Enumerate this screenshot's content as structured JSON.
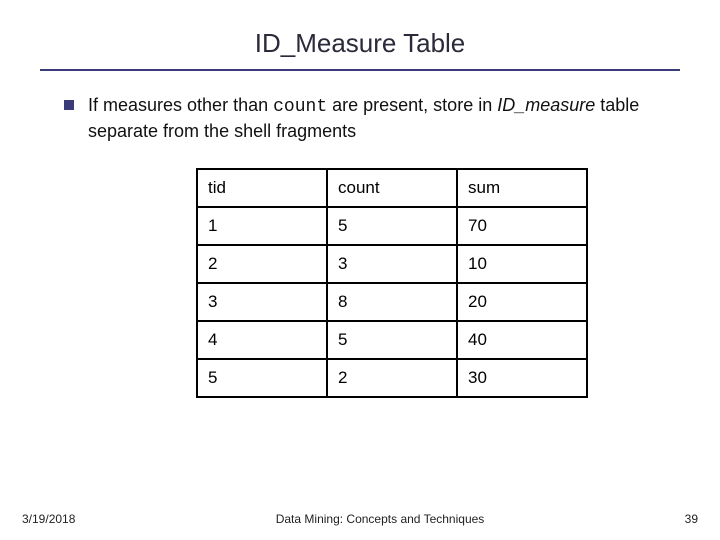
{
  "title": "ID_Measure Table",
  "bullet": {
    "pre": "If measures other than ",
    "code": "count",
    "mid": " are present, store in ",
    "em": "ID_measure",
    "post": " table separate from the shell fragments"
  },
  "chart_data": {
    "type": "table",
    "headers": [
      "tid",
      "count",
      "sum"
    ],
    "rows": [
      [
        "1",
        "5",
        "70"
      ],
      [
        "2",
        "3",
        "10"
      ],
      [
        "3",
        "8",
        "20"
      ],
      [
        "4",
        "5",
        "40"
      ],
      [
        "5",
        "2",
        "30"
      ]
    ]
  },
  "footer": {
    "date": "3/19/2018",
    "center": "Data Mining: Concepts and Techniques",
    "page": "39"
  }
}
